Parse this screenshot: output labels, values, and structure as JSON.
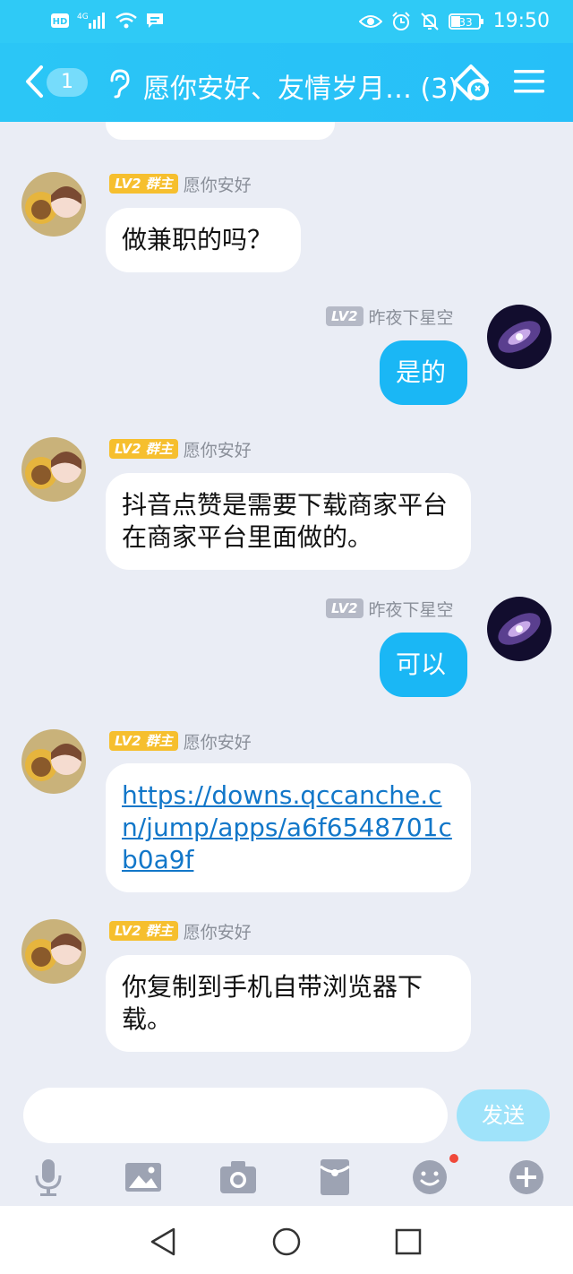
{
  "status_bar": {
    "network": "4G",
    "battery": "33",
    "time": "19:50"
  },
  "header": {
    "back_badge": "1",
    "title": "愿你安好、友情岁月… (3)"
  },
  "messages": [
    {
      "direction": "in",
      "level": "LV2",
      "role": "群主",
      "sender": "愿你安好",
      "text": "做兼职的吗？"
    },
    {
      "direction": "out",
      "level": "LV2",
      "sender": "昨夜下星空",
      "text": "是的"
    },
    {
      "direction": "in",
      "level": "LV2",
      "role": "群主",
      "sender": "愿你安好",
      "text": "抖音点赞是需要下载商家平台在商家平台里面做的。"
    },
    {
      "direction": "out",
      "level": "LV2",
      "sender": "昨夜下星空",
      "text": "可以"
    },
    {
      "direction": "in",
      "level": "LV2",
      "role": "群主",
      "sender": "愿你安好",
      "text": "https://downs.qccanche.cn/jump/apps/a6f6548701cb0a9f"
    },
    {
      "direction": "in",
      "level": "LV2",
      "role": "群主",
      "sender": "愿你安好",
      "text": "你复制到手机自带浏览器下载。"
    }
  ],
  "composer": {
    "input_value": "",
    "send_label": "发送"
  },
  "toolbar": {
    "icons": [
      "microphone-icon",
      "image-icon",
      "camera-icon",
      "red-packet-icon",
      "emoji-icon",
      "plus-icon"
    ],
    "notification_dot_color": "#f0493a"
  },
  "colors": {
    "header": "#2bc6f6",
    "outgoing_bubble": "#1ab7f5",
    "owner_badge": "#f6bf2e",
    "link": "#1277c9"
  }
}
